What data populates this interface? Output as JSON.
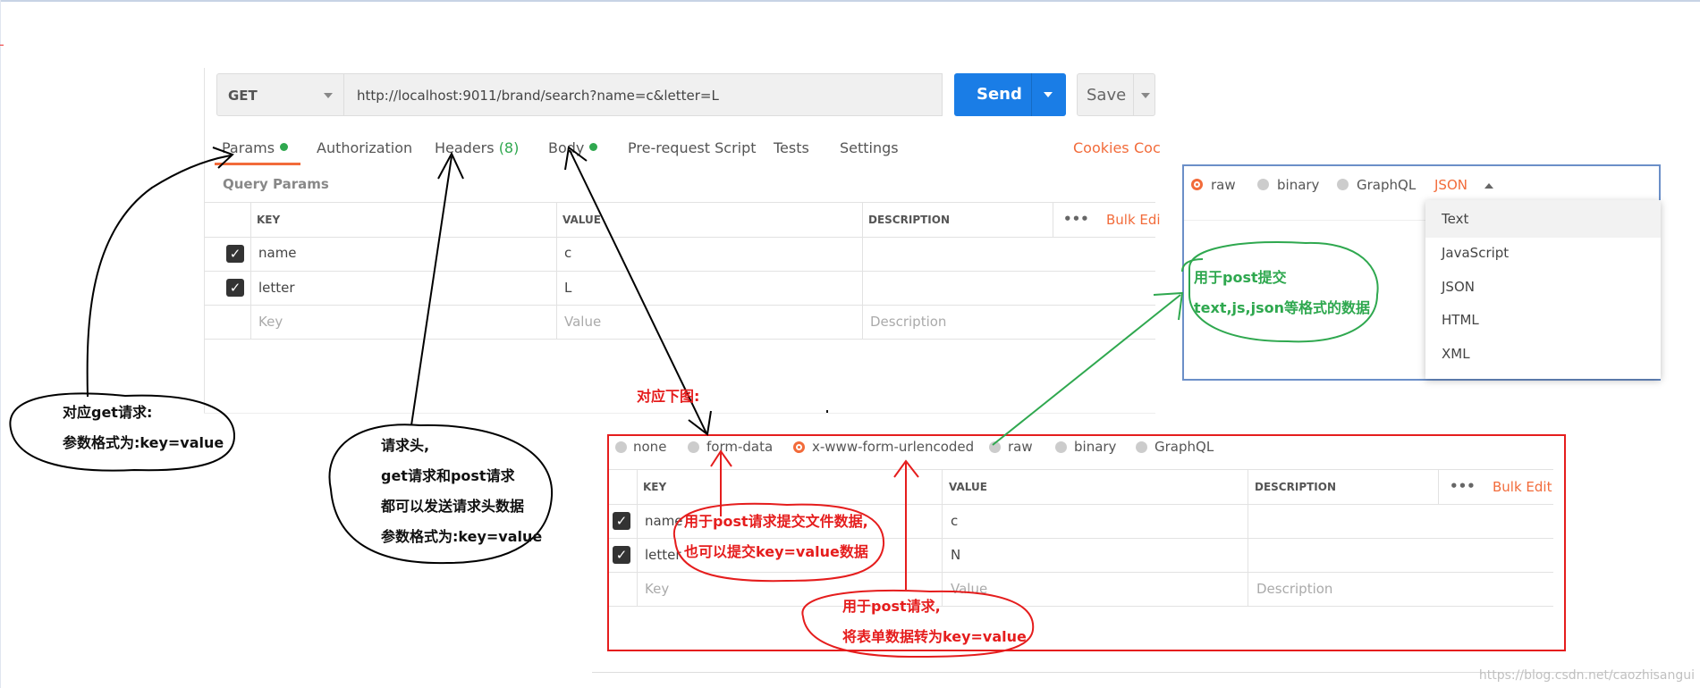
{
  "request": {
    "method": "GET",
    "url": "http://localhost:9011/brand/search?name=c&letter=L",
    "send_label": "Send",
    "save_label": "Save"
  },
  "tabs": {
    "params": "Params",
    "authorization": "Authorization",
    "headers": "Headers",
    "headers_count": "(8)",
    "body": "Body",
    "prerequest": "Pre-request Script",
    "tests": "Tests",
    "settings": "Settings",
    "cookies": "Cookies",
    "code": "Coc"
  },
  "query_params": {
    "title": "Query Params",
    "headers": {
      "key": "KEY",
      "value": "VALUE",
      "description": "DESCRIPTION",
      "more": "•••",
      "bulk_edit": "Bulk Edi"
    },
    "rows": [
      {
        "key": "name",
        "value": "c"
      },
      {
        "key": "letter",
        "value": "L"
      }
    ],
    "placeholders": {
      "key": "Key",
      "value": "Value",
      "description": "Description"
    }
  },
  "raw_panel": {
    "options": [
      "raw",
      "binary",
      "GraphQL"
    ],
    "format": "JSON",
    "format_options": [
      "Text",
      "JavaScript",
      "JSON",
      "HTML",
      "XML"
    ]
  },
  "body_panel": {
    "options": [
      "none",
      "form-data",
      "x-www-form-urlencoded",
      "raw",
      "binary",
      "GraphQL"
    ],
    "selected": "x-www-form-urlencoded",
    "headers": {
      "key": "KEY",
      "value": "VALUE",
      "description": "DESCRIPTION",
      "more": "•••",
      "bulk_edit": "Bulk Edit"
    },
    "rows": [
      {
        "key": "name",
        "value": "c"
      },
      {
        "key": "letter",
        "value": "N"
      }
    ],
    "placeholders": {
      "key": "Key",
      "value": "Value",
      "description": "Description"
    }
  },
  "annotations": {
    "get_line1": "对应get请求:",
    "get_line2": "参数格式为:key=value",
    "headers_line1": "请求头,",
    "headers_line2": "get请求和post请求",
    "headers_line3": "都可以发送请求头数据",
    "headers_line4": "参数格式为:key=value",
    "below": "对应下图:",
    "raw_line1": "用于post提交",
    "raw_line2": "text,js,json等格式的数据",
    "formdata_line1": "用于post请求提交文件数据,",
    "formdata_line2": "也可以提交key=value数据",
    "urlenc_line1": "用于post请求,",
    "urlenc_line2": "将表单数据转为key=value"
  },
  "watermark": "https://blog.csdn.net/caozhisangui",
  "colors": {
    "send_blue": "#1a7de6",
    "accent_orange": "#f26b3a",
    "green": "#2fa84f",
    "red": "#e51d1d",
    "blue_border": "#6b8fc8"
  }
}
